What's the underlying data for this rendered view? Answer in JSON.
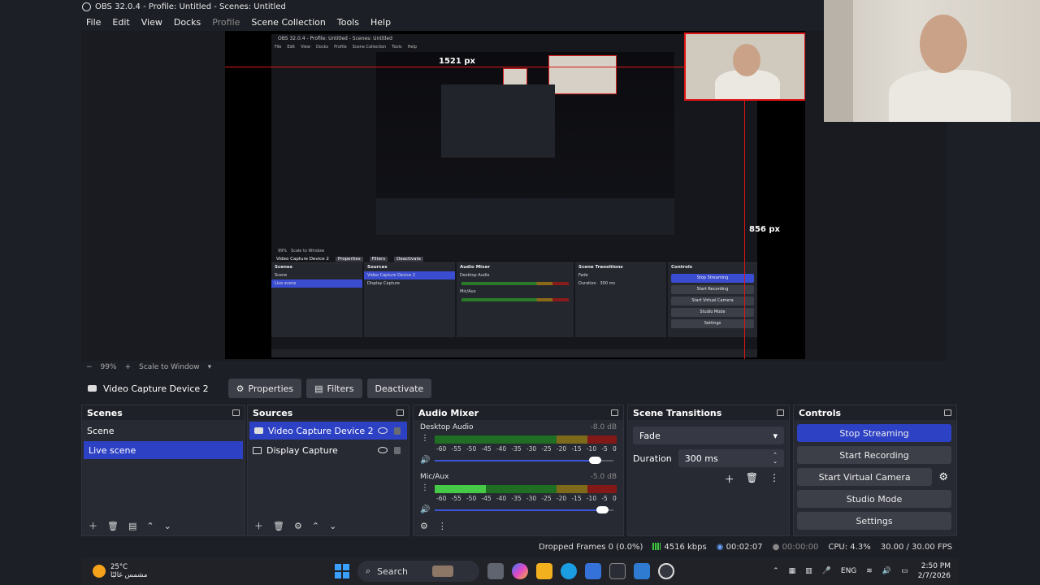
{
  "window": {
    "title": "OBS 32.0.4 - Profile: Untitled - Scenes: Untitled",
    "menu": [
      {
        "label": "File",
        "enabled": true
      },
      {
        "label": "Edit",
        "enabled": true
      },
      {
        "label": "View",
        "enabled": true
      },
      {
        "label": "Docks",
        "enabled": true
      },
      {
        "label": "Profile",
        "enabled": false
      },
      {
        "label": "Scene Collection",
        "enabled": true
      },
      {
        "label": "Tools",
        "enabled": true
      },
      {
        "label": "Help",
        "enabled": true
      }
    ]
  },
  "preview": {
    "measure_h": "1521 px",
    "measure_v": "856 px",
    "measure_v2": "856 px",
    "nested": {
      "title": "OBS 32.0.4 - Profile: Untitled - Scenes: Untitled",
      "menu": [
        "File",
        "Edit",
        "View",
        "Docks",
        "Profile",
        "Scene Collection",
        "Tools",
        "Help"
      ],
      "zoom": "99%",
      "scale_mode": "Scale to Window",
      "source_name": "Video Capture Device 2",
      "toolbar": [
        "Properties",
        "Filters",
        "Deactivate"
      ],
      "docks": {
        "scenes_title": "Scenes",
        "scenes": [
          "Scene",
          "Live scene"
        ],
        "sources_title": "Sources",
        "sources": [
          "Video Capture Device 2",
          "Display Capture"
        ],
        "mixer_title": "Audio Mixer",
        "mixer_channels": [
          "Desktop Audio",
          "Mic/Aux"
        ],
        "transitions_title": "Scene Transitions",
        "transition": "Fade",
        "duration_label": "Duration",
        "duration": "300 ms",
        "controls_title": "Controls",
        "controls": [
          "Stop Streaming",
          "Start Recording",
          "Start Virtual Camera",
          "Studio Mode",
          "Settings"
        ]
      }
    }
  },
  "zoombar": {
    "zoom": "99%",
    "scale_mode": "Scale to Window"
  },
  "source_toolbar": {
    "source_name": "Video Capture Device 2",
    "properties": "Properties",
    "filters": "Filters",
    "deactivate": "Deactivate"
  },
  "scenes": {
    "title": "Scenes",
    "items": [
      "Scene",
      "Live scene"
    ],
    "selected_index": 1
  },
  "sources": {
    "title": "Sources",
    "items": [
      "Video Capture Device 2",
      "Display Capture"
    ],
    "selected_index": 0
  },
  "mixer": {
    "title": "Audio Mixer",
    "channels": [
      {
        "name": "Desktop Audio",
        "db": "-8.0 dB",
        "level": 0.0,
        "volume": 0.9
      },
      {
        "name": "Mic/Aux",
        "db": "-5.0 dB",
        "level": 0.28,
        "volume": 0.94
      }
    ],
    "scale": [
      "-60",
      "-55",
      "-50",
      "-45",
      "-40",
      "-35",
      "-30",
      "-25",
      "-20",
      "-15",
      "-10",
      "-5",
      "0"
    ]
  },
  "transitions": {
    "title": "Scene Transitions",
    "selected": "Fade",
    "duration_label": "Duration",
    "duration": "300 ms"
  },
  "controls": {
    "title": "Controls",
    "stop_streaming": "Stop Streaming",
    "start_recording": "Start Recording",
    "start_virtual_camera": "Start Virtual Camera",
    "studio_mode": "Studio Mode",
    "settings": "Settings"
  },
  "status": {
    "dropped_frames": "Dropped Frames 0 (0.0%)",
    "bitrate": "4516 kbps",
    "stream_time": "00:02:07",
    "record_time": "00:00:00",
    "cpu": "CPU: 4.3%",
    "fps": "30.00 / 30.00 FPS"
  },
  "taskbar": {
    "temperature": "25°C",
    "weather": "مشمس غالبًا",
    "search": "Search",
    "language": "ENG",
    "time": "2:50 PM",
    "date": "2/7/2026"
  },
  "colors": {
    "accent": "#2d41c5",
    "measure_line": "#e01515",
    "meter_green": "#1f6e23",
    "meter_yellow": "#7d6a1a",
    "meter_red": "#821818"
  }
}
